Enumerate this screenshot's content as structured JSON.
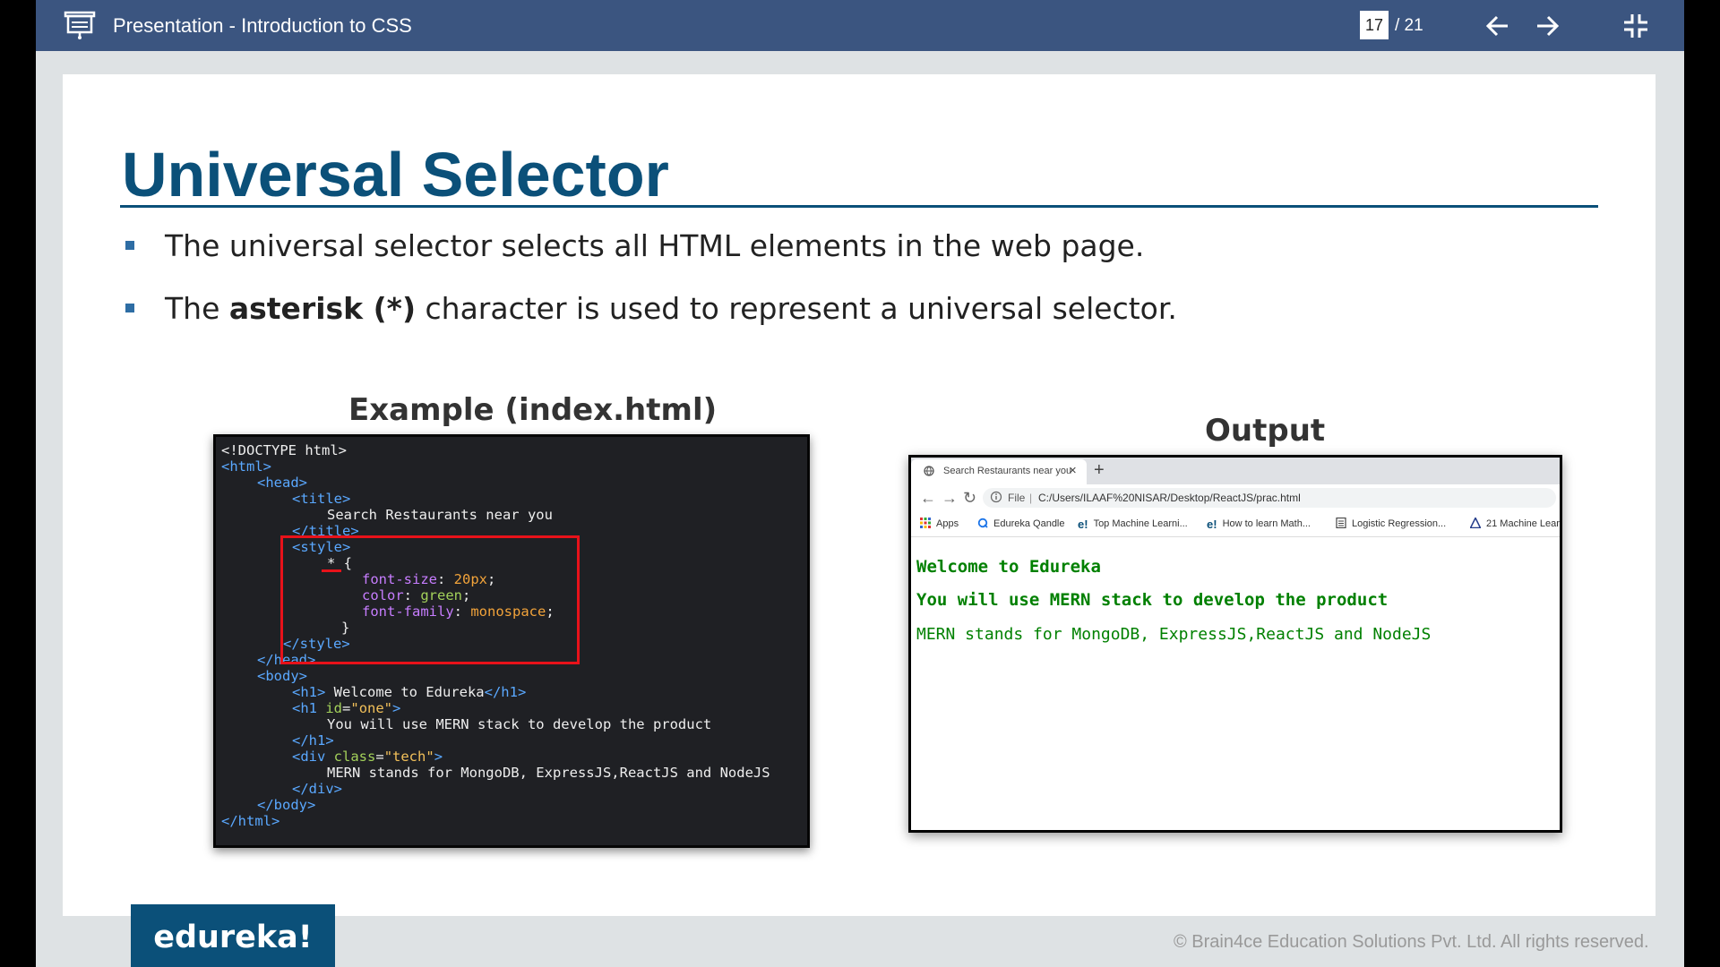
{
  "topbar": {
    "title": "Presentation - Introduction to CSS",
    "current_page": "17",
    "total_pages": "/ 21"
  },
  "slide": {
    "heading": "Universal Selector",
    "bullets": {
      "b1": "The universal selector selects all HTML elements in the web page.",
      "b2_pre": "The ",
      "b2_bold": "asterisk (*)",
      "b2_post": " character is used to represent a universal selector."
    },
    "example_caption": "Example (index.html)",
    "output_caption": "Output",
    "code": {
      "doctype": "<!DOCTYPE html>",
      "html_open": "<html>",
      "head_open": "<head>",
      "title_open": "<title>",
      "title_text": "Search Restaurants near you",
      "title_close": "</title>",
      "style_open": "<style>",
      "selector": "* {",
      "p1": "font-size",
      "v1": "20px",
      "p2": "color",
      "v2": "green",
      "p3": "font-family",
      "v3": "monospace",
      "rule_close": "}",
      "style_close": "</style>",
      "head_close": "</head>",
      "body_open": "<body>",
      "h1_open": "<h1>",
      "h1_text": " Welcome to Edureka",
      "h1_close": "</h1>",
      "h1b_open": "<h1",
      "h1b_attr": "id",
      "h1b_val": "\"one\"",
      "h1b_text": "You will use MERN stack to develop the product",
      "h1b_close": "</h1>",
      "div_open": "<div",
      "div_attr": "class",
      "div_val": "\"tech\"",
      "div_text": "MERN stands for MongoDB, ExpressJS,ReactJS and NodeJS",
      "div_close": "</div>",
      "body_close": "</body>",
      "html_close": "</html>"
    },
    "browser": {
      "tab_title": "Search Restaurants near you",
      "tab_close": "×",
      "new_tab": "+",
      "address_scheme": "File",
      "address_sep": "|",
      "address_path": "C:/Users/ILAAF%20NISAR/Desktop/ReactJS/prac.html",
      "bookmarks": {
        "apps": "Apps",
        "qandle": "Edureka Qandle",
        "ml1": "Top Machine Learni...",
        "math": "How to learn Math...",
        "logistic": "Logistic Regression...",
        "ml2": "21 Machine Lear"
      },
      "line1": "Welcome to Edureka",
      "line2": "You will use MERN stack to develop the product",
      "line3": "MERN stands for MongoDB, ExpressJS,ReactJS and NodeJS"
    },
    "logo": "edureka!",
    "copyright": "© Brain4ce Education Solutions Pvt. Ltd. All rights reserved."
  },
  "colors": {
    "topbar": "#3b5580",
    "heading": "#0b5079",
    "highlight": "#e8121a",
    "output_text": "#008000"
  }
}
